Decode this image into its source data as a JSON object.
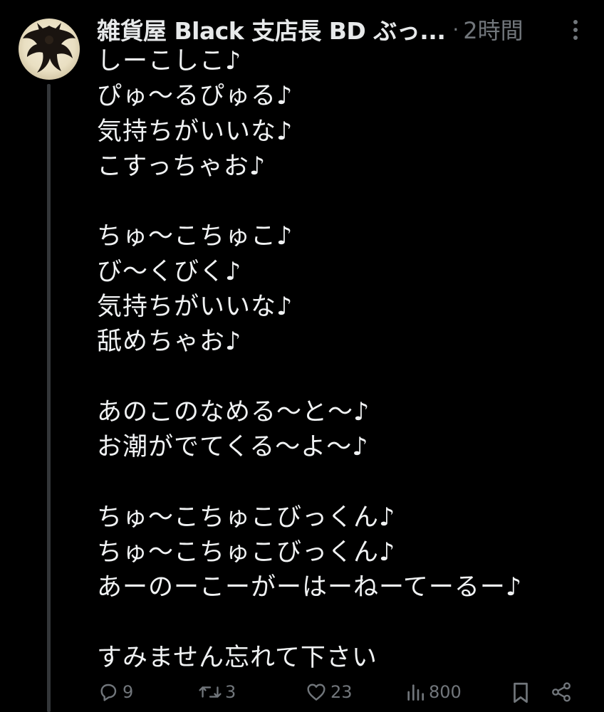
{
  "tweet": {
    "author": {
      "display_name": "雑貨屋 Black 支店長 BD ぶっ...",
      "avatar_icon": "dark-winged-figure-avatar"
    },
    "separator": "·",
    "time_ago": "2時間",
    "more_icon": "more-vertical-icon",
    "text": "しーこしこ♪\nぴゅ〜るぴゅる♪\n気持ちがいいな♪\nこすっちゃお♪\n\nちゅ〜こちゅこ♪\nび〜くびく♪\n気持ちがいいな♪\n舐めちゃお♪\n\nあのこのなめる〜と〜♪\nお潮がでてくる〜よ〜♪\n\nちゅ〜こちゅこびっくん♪\nちゅ〜こちゅこびっくん♪\nあーのーこーがーはーねーてーるー♪\n\nすみません忘れて下さい"
  },
  "actions": {
    "reply": {
      "icon": "reply-icon",
      "count": "9"
    },
    "repost": {
      "icon": "repost-icon",
      "count": "3"
    },
    "like": {
      "icon": "like-icon",
      "count": "23"
    },
    "views": {
      "icon": "views-icon",
      "count": "800"
    },
    "bookmark": {
      "icon": "bookmark-icon"
    },
    "share": {
      "icon": "share-icon"
    }
  },
  "colors": {
    "background": "#000000",
    "text": "#e7e9ea",
    "muted": "#71767b",
    "thread_line": "#333639"
  }
}
